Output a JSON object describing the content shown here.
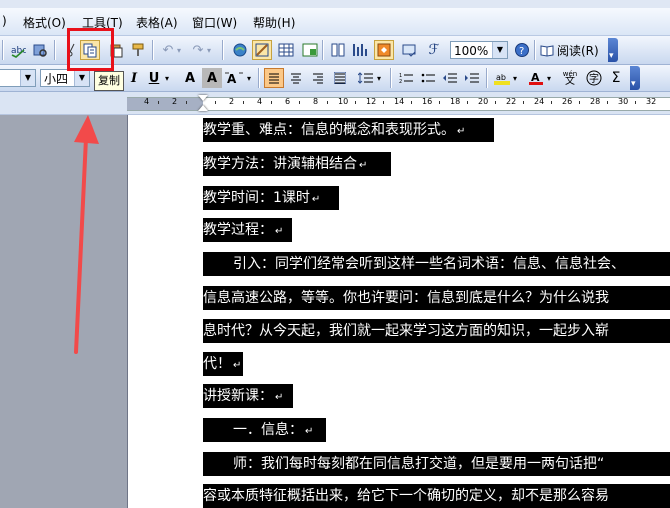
{
  "menu": {
    "items": [
      {
        "label": ")"
      },
      {
        "label": "格式(O)"
      },
      {
        "label": "工具(T)"
      },
      {
        "label": "表格(A)"
      },
      {
        "label": "窗口(W)"
      },
      {
        "label": "帮助(H)"
      }
    ]
  },
  "toolbar1": {
    "zoom_value": "100%",
    "read_label": "阅读(R)"
  },
  "toolbar2": {
    "font_size": "小四",
    "copy_tooltip": "复制",
    "italic": "I",
    "underline": "U",
    "char_a": "A",
    "char_a2": "A",
    "sigma": "Σ",
    "wen": "wén"
  },
  "ruler": {
    "labels": [
      "4",
      "2",
      "2",
      "4",
      "6",
      "8",
      "10",
      "12",
      "14",
      "16",
      "18",
      "20",
      "22",
      "24",
      "26",
      "28",
      "30",
      "32"
    ]
  },
  "document": {
    "lines": [
      "教学重、难点：信息的概念和表现形式。",
      "教学方法：讲演辅相结合",
      "教学时间：1课时",
      "教学过程：",
      "引入：同学们经常会听到这样一些名词术语：信息、信息社会、",
      "信息高速公路，等等。你也许要问：信息到底是什么？为什么说我",
      "息时代？从今天起，我们就一起来学习这方面的知识，一起步入崭",
      "代！",
      "讲授新课：",
      "一．信息：",
      "师：我们每时每刻都在同信息打交道，但是要用一两句话把“",
      "容或本质特征概括出来，给它下一个确切的定义，却不是那么容易"
    ],
    "para_mark": "↵"
  },
  "colors": {
    "highlight": "#e8101a",
    "selection": "#000000"
  }
}
